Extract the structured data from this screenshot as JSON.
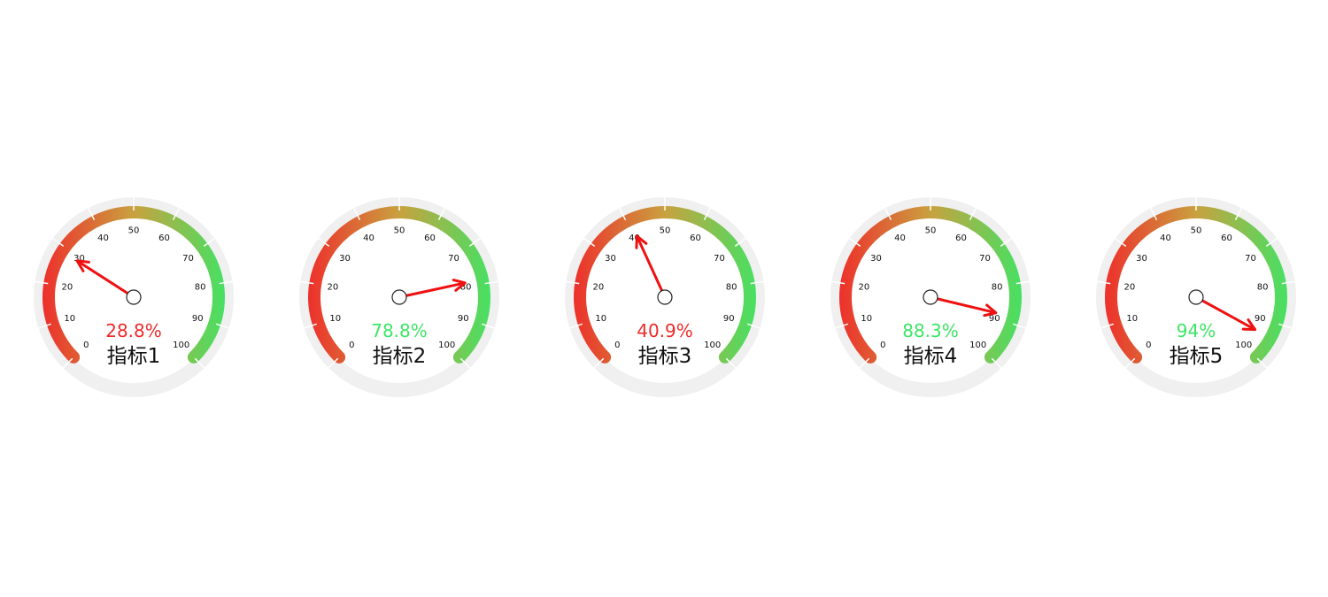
{
  "chart_data": {
    "type": "gauge",
    "axis": {
      "min": 0,
      "max": 100,
      "ticks": [
        0,
        10,
        20,
        30,
        40,
        50,
        60,
        70,
        80,
        90,
        100
      ]
    },
    "colors": {
      "low": "#f0282a",
      "mid": "#c9a13f",
      "high": "#3de565",
      "pointer": "#ee1111",
      "track": "#f0f0f0",
      "label": "#111111"
    },
    "gauges": [
      {
        "name": "指标1",
        "value": 28.8,
        "value_label": "28.8%",
        "value_color": "#ee2a2a"
      },
      {
        "name": "指标2",
        "value": 78.8,
        "value_label": "78.8%",
        "value_color": "#3de565"
      },
      {
        "name": "指标3",
        "value": 40.9,
        "value_label": "40.9%",
        "value_color": "#ee2a2a"
      },
      {
        "name": "指标4",
        "value": 88.3,
        "value_label": "88.3%",
        "value_color": "#3de565"
      },
      {
        "name": "指标5",
        "value": 94,
        "value_label": "94%",
        "value_color": "#3de565"
      }
    ]
  }
}
